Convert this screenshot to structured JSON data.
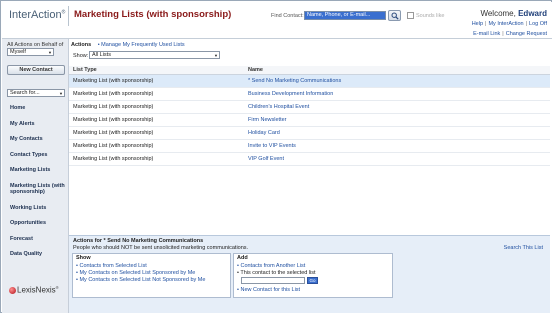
{
  "header": {
    "logo": "InterAction",
    "logo_mark": "®",
    "page_title": "Marketing Lists (with sponsorship)",
    "find_label": "Find Contact:",
    "find_value": "Name, Phone, or E-mail...",
    "sounds_like": "Sounds like",
    "welcome_prefix": "Welcome,",
    "welcome_name": "Edward",
    "links": [
      "Help",
      "My InterAction",
      "Log Off"
    ],
    "sublinks": [
      "E-mail Link",
      "Change Request"
    ]
  },
  "sidebar": {
    "behalf_label": "All Actions on Behalf of",
    "behalf_value": "Myself",
    "new_contact": "New Contact",
    "search_placeholder": "Search for...",
    "nav": [
      "Home",
      "My Alerts",
      "My Contacts",
      "Contact Types",
      "Marketing Lists",
      "Marketing Lists (with sponsorship)",
      "Working Lists",
      "Opportunities",
      "Forecast",
      "Data Quality"
    ],
    "brand": "LexisNexis"
  },
  "main": {
    "actions_title": "Actions",
    "manage_link": "Manage My Frequently Used Lists",
    "show_label": "Show:",
    "show_value": "All Lists",
    "columns": [
      "List Type",
      "Name"
    ],
    "rows": [
      {
        "type": "Marketing List (with sponsorship)",
        "name": "* Send No Marketing Communications"
      },
      {
        "type": "Marketing List (with sponsorship)",
        "name": "Business Development Information"
      },
      {
        "type": "Marketing List (with sponsorship)",
        "name": "Children's Hospital Event"
      },
      {
        "type": "Marketing List (with sponsorship)",
        "name": "Firm Newsletter"
      },
      {
        "type": "Marketing List (with sponsorship)",
        "name": "Holiday Card"
      },
      {
        "type": "Marketing List (with sponsorship)",
        "name": "Invite to VIP Events"
      },
      {
        "type": "Marketing List (with sponsorship)",
        "name": "VIP Golf Event"
      }
    ]
  },
  "bottom": {
    "title": "Actions for * Send No Marketing Communications",
    "description": "People who should NOT be sent unsolicited marketing communications.",
    "search_link": "Search This List",
    "show_title": "Show",
    "show_links": [
      "Contacts from Selected List",
      "My Contacts on Selected List Sponsored by Me",
      "My Contacts on Selected List Not Sponsored by Me"
    ],
    "add_title": "Add",
    "add_link1": "Contacts from Another List",
    "add_text": "This contact to the selected list",
    "go": "Go",
    "add_link2": "New Contact for this List"
  }
}
